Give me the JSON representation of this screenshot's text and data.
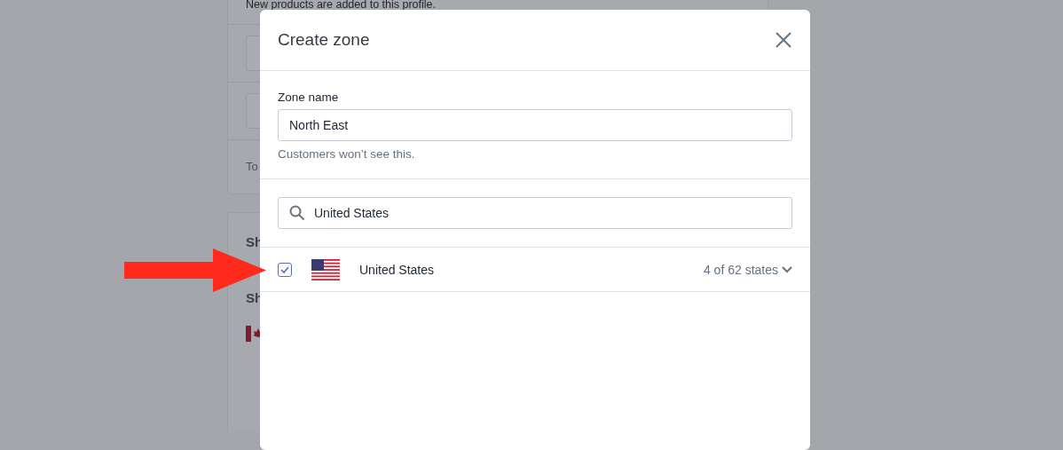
{
  "background_page": {
    "intro_text": "New products are added to this profile.",
    "note_text": "To",
    "section_headings": [
      "Sh",
      "Sh"
    ]
  },
  "modal": {
    "title": "Create zone",
    "zone_name": {
      "label": "Zone name",
      "value": "North East",
      "help": "Customers won’t see this."
    },
    "search": {
      "value": "United States"
    },
    "countries": [
      {
        "name": "United States",
        "checked": true,
        "count": "4 of 62 states"
      }
    ]
  }
}
